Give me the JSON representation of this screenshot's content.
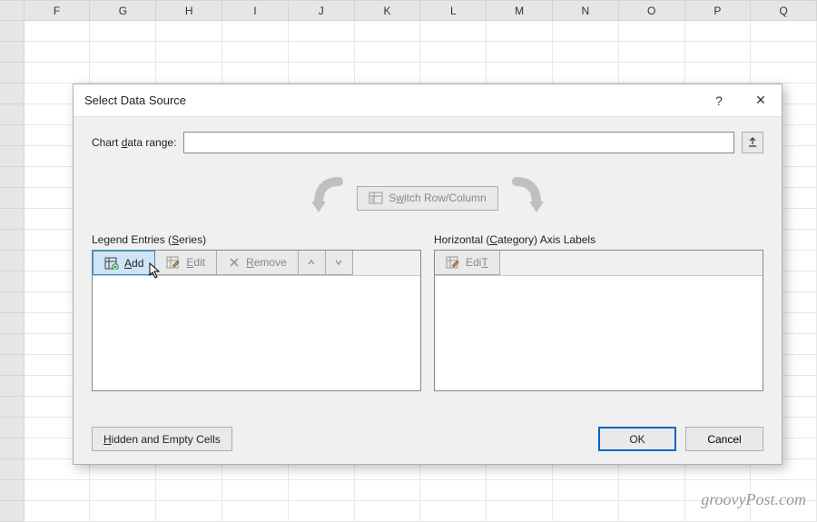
{
  "sheet": {
    "columns": [
      "F",
      "G",
      "H",
      "I",
      "J",
      "K",
      "L",
      "M",
      "N",
      "O",
      "P",
      "Q"
    ]
  },
  "dialog": {
    "title": "Select Data Source",
    "help_label": "?",
    "close_label": "✕",
    "range_label_pre": "Chart ",
    "range_label_u": "d",
    "range_label_post": "ata range:",
    "range_value": "",
    "switch_pre": "S",
    "switch_u": "w",
    "switch_post": "itch Row/Column",
    "legend": {
      "title_pre": "Legend Entries (",
      "title_u": "S",
      "title_post": "eries)",
      "add_u": "A",
      "add_post": "dd",
      "edit_u": "E",
      "edit_post": "dit",
      "remove_u": "R",
      "remove_post": "emove"
    },
    "axis": {
      "title_pre": "Horizontal (",
      "title_u": "C",
      "title_post": "ategory) Axis Labels",
      "edit_u": "T",
      "edit_pre": "Edi",
      "edit_suffix": ""
    },
    "hidden_u": "H",
    "hidden_post": "idden and Empty Cells",
    "ok": "OK",
    "cancel": "Cancel"
  },
  "watermark": "groovyPost.com"
}
